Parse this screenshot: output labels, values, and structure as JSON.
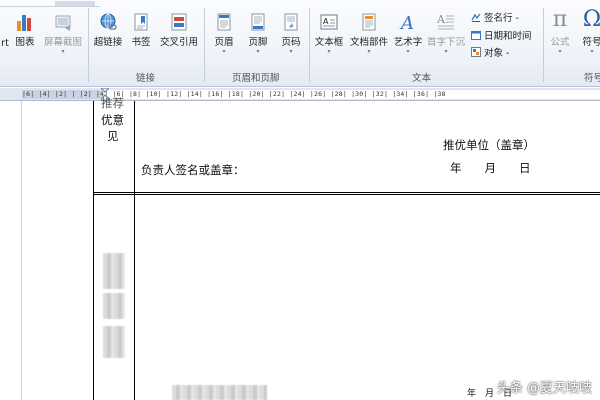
{
  "ribbon": {
    "partial_left_label": "rt",
    "buttons": [
      {
        "label": "图表",
        "dim": false
      },
      {
        "label": "屏幕截图",
        "dim": true
      },
      {
        "label": "超链接",
        "dim": false
      },
      {
        "label": "书签",
        "dim": false
      },
      {
        "label": "交叉引用",
        "dim": false
      },
      {
        "label": "页眉",
        "dim": false
      },
      {
        "label": "页脚",
        "dim": false
      },
      {
        "label": "页码",
        "dim": false
      },
      {
        "label": "文本框",
        "dim": false
      },
      {
        "label": "文档部件",
        "dim": false
      },
      {
        "label": "艺术字",
        "dim": false
      },
      {
        "label": "首字下沉",
        "dim": true
      },
      {
        "label": "公式",
        "dim": true
      },
      {
        "label": "符号",
        "dim": false
      }
    ],
    "small_items": [
      {
        "label": "签名行 -"
      },
      {
        "label": "日期和时间"
      },
      {
        "label": "对象 -"
      }
    ],
    "groups": {
      "links": "链接",
      "header_footer": "页眉和页脚",
      "text": "文本",
      "symbols": "符号"
    }
  },
  "ruler": {
    "ticks": "|6| |4| |2| |  |2| |4| |6| |8| |10| |12| |14| |16| |18| |20| |22| |24| |26| |28| |30| |32| |34| |36| |38"
  },
  "document": {
    "row1_label_lines": [
      "推荐",
      "优意",
      "见"
    ],
    "recommend_unit": "推优单位（盖章）",
    "signature_label": "负责人签名或盖章：",
    "date_top": "年　　月　　日",
    "date_bottom": "年　月　日"
  },
  "watermark": "头条 @夏天吱吱"
}
